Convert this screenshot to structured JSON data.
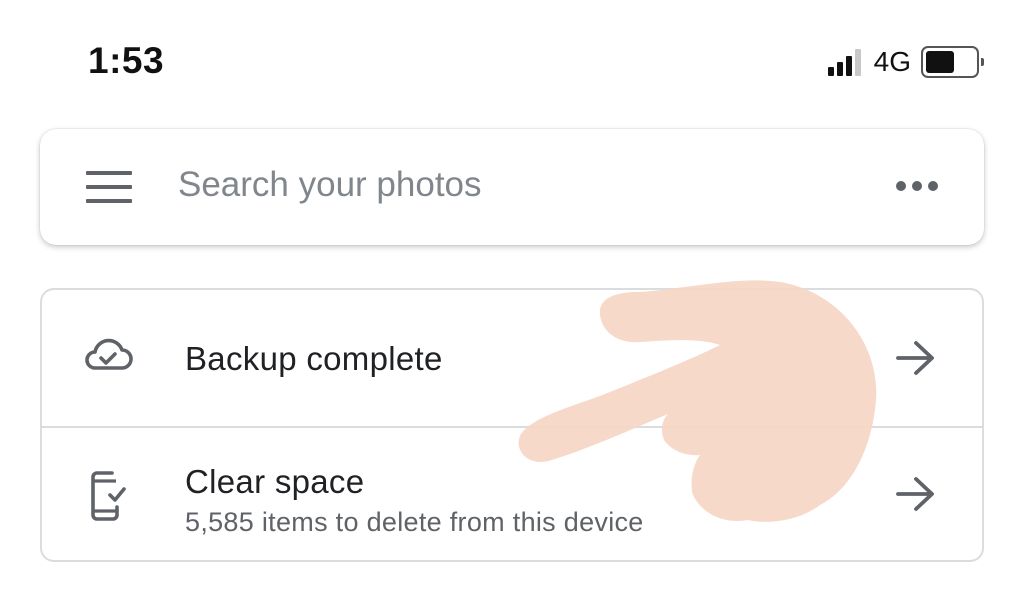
{
  "status_bar": {
    "time": "1:53",
    "network": "4G",
    "signal_icon": "signal-bars-icon",
    "battery_icon": "battery-icon",
    "battery_level_fraction": 0.58
  },
  "search_bar": {
    "placeholder": "Search your photos",
    "menu_icon": "hamburger-menu-icon",
    "more_icon": "more-horizontal-icon"
  },
  "card": {
    "rows": [
      {
        "icon": "cloud-check-icon",
        "title": "Backup complete",
        "action_icon": "arrow-right-icon"
      },
      {
        "icon": "phone-check-icon",
        "title": "Clear space",
        "subtitle": "5,585 items to delete from this device",
        "action_icon": "arrow-right-icon"
      }
    ]
  },
  "colors": {
    "text_primary": "#202124",
    "text_secondary": "#5f6368",
    "placeholder": "#80868b",
    "border": "#dadce0",
    "finger_overlay": "#f6d6c6"
  }
}
